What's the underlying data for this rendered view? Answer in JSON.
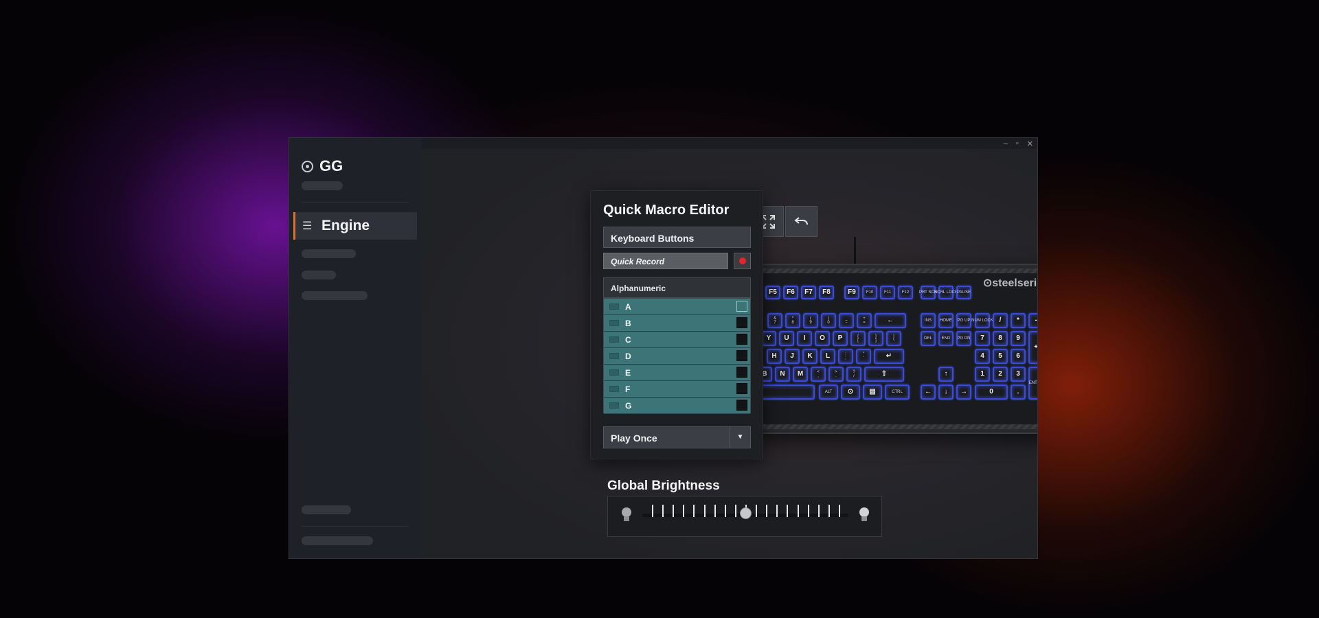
{
  "window": {
    "controls": [
      "–",
      "▫",
      "✕"
    ]
  },
  "sidebar": {
    "brand": "GG",
    "active_item": {
      "label": "Engine",
      "icon": "sliders-icon"
    }
  },
  "quick_macro_editor": {
    "title": "Quick Macro Editor",
    "category_select": "Keyboard Buttons",
    "quick_record": "Quick Record",
    "section": "Alphanumeric",
    "keys": [
      {
        "label": "A",
        "checked": false
      },
      {
        "label": "B",
        "checked": false
      },
      {
        "label": "C",
        "checked": false
      },
      {
        "label": "D",
        "checked": false
      },
      {
        "label": "E",
        "checked": false
      },
      {
        "label": "F",
        "checked": false
      },
      {
        "label": "G",
        "checked": false
      }
    ],
    "playback_mode": "Play Once",
    "dropdown_arrow": "▼"
  },
  "toolbar": {
    "tools": [
      "pointer-icon",
      "select-box-icon",
      "fullscreen-icon",
      "undo-icon"
    ]
  },
  "keyboard": {
    "brand": "⊙steelseries",
    "keys": [
      "F5",
      "F6",
      "F7",
      "F8",
      "F9",
      "F10",
      "F11",
      "F12",
      "PRT SCR",
      "SCRL LOCK",
      "PAUSE",
      "&\n7",
      "*\n8",
      "(\n9",
      ")\n0",
      "_\n-",
      "+\n=",
      "←",
      "INS",
      "HOME",
      "PG UP",
      "NUM LOCK",
      "/",
      "*",
      "-",
      "Y",
      "U",
      "I",
      "O",
      "P",
      "{\n[",
      "}\n]",
      "|\n\\",
      "DEL",
      "END",
      "PG DN",
      "7",
      "8",
      "9",
      "+",
      "H",
      "J",
      "K",
      "L",
      ":\n;",
      "\"\n'",
      "↵",
      "4",
      "5",
      "6",
      "B",
      "N",
      "M",
      "<\n,",
      ">\n.",
      "?\n/",
      "⇧",
      "↑",
      "1",
      "2",
      "3",
      "ENTER",
      "ALT",
      "⊙",
      "▤",
      "CTRL",
      "←",
      "↓",
      "→",
      "0",
      "."
    ]
  },
  "brightness": {
    "title": "Global Brightness",
    "value": 0.5,
    "ticks": 19
  }
}
